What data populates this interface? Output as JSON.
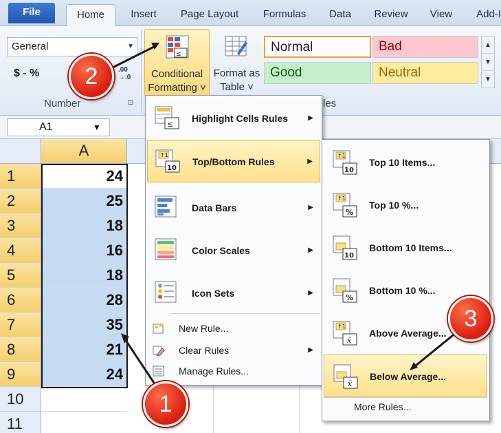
{
  "ribbon_tabs": [
    "File",
    "Home",
    "Insert",
    "Page Layout",
    "Formulas",
    "Data",
    "Review",
    "View",
    "Add-I"
  ],
  "number_group": {
    "format_value": "General",
    "symbols": "$  -  %",
    "increase_decimal": ".00",
    "decrease_decimal": "→.0",
    "group_label": "Number"
  },
  "styles_group": {
    "conditional_formatting_line1": "Conditional",
    "conditional_formatting_line2": "Formatting ˅",
    "format_as_table_line1": "Format as",
    "format_as_table_line2": "Table ˅",
    "normal": "Normal",
    "bad": "Bad",
    "good": "Good",
    "neutral": "Neutral",
    "group_label": "Styles",
    "group_label_visible": "les"
  },
  "formula_bar": {
    "name_box": "A1"
  },
  "sheet": {
    "column": "A",
    "rows": [
      "1",
      "2",
      "3",
      "4",
      "5",
      "6",
      "7",
      "8",
      "9",
      "10",
      "11"
    ],
    "values": [
      "24",
      "25",
      "18",
      "16",
      "18",
      "28",
      "35",
      "21",
      "24"
    ]
  },
  "cf_menu": {
    "items": [
      "Highlight Cells Rules",
      "Top/Bottom Rules",
      "Data Bars",
      "Color Scales",
      "Icon Sets"
    ],
    "small_items": [
      "New Rule...",
      "Clear Rules",
      "Manage Rules..."
    ]
  },
  "topbottom_menu": {
    "items": [
      "Top 10 Items...",
      "Top 10 %...",
      "Bottom 10 Items...",
      "Bottom 10 %...",
      "Above Average...",
      "Below Average..."
    ],
    "more": "More Rules..."
  },
  "callouts": [
    "1",
    "2",
    "3"
  ],
  "colors": {
    "selected_fill": "#c5dbf2",
    "highlight": "#ffe08c",
    "callout_red": "#d91f0f"
  }
}
